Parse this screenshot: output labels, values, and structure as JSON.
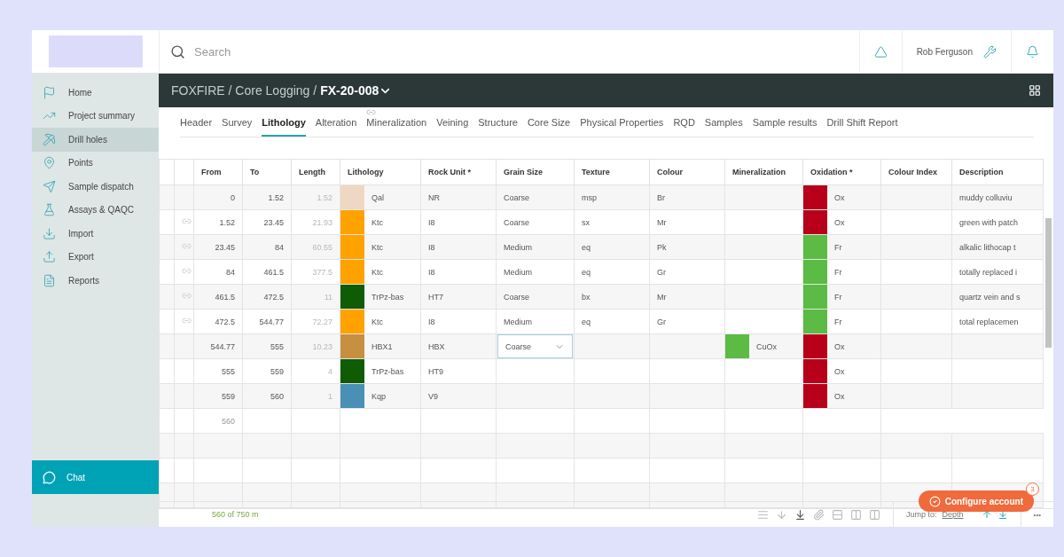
{
  "search": {
    "placeholder": "Search"
  },
  "user": {
    "name": "Rob Ferguson"
  },
  "sidebar": {
    "items": [
      {
        "label": "Home",
        "selected": false
      },
      {
        "label": "Project summary",
        "selected": false
      },
      {
        "label": "Drill holes",
        "selected": true
      },
      {
        "label": "Points",
        "selected": false
      },
      {
        "label": "Sample dispatch",
        "selected": false
      },
      {
        "label": "Assays & QAQC",
        "selected": false
      },
      {
        "label": "Import",
        "selected": false
      },
      {
        "label": "Export",
        "selected": false
      },
      {
        "label": "Reports",
        "selected": false
      }
    ],
    "chat": "Chat"
  },
  "breadcrumb": {
    "path": "FOXFIRE / Core Logging /",
    "current": "FX-20-008"
  },
  "tabs": [
    {
      "label": "Header",
      "selected": false,
      "linked": false
    },
    {
      "label": "Survey",
      "selected": false,
      "linked": false
    },
    {
      "label": "Lithology",
      "selected": true,
      "linked": false
    },
    {
      "label": "Alteration",
      "selected": false,
      "linked": false
    },
    {
      "label": "Mineralization",
      "selected": false,
      "linked": true
    },
    {
      "label": "Veining",
      "selected": false,
      "linked": false
    },
    {
      "label": "Structure",
      "selected": false,
      "linked": false
    },
    {
      "label": "Core Size",
      "selected": false,
      "linked": false
    },
    {
      "label": "Physical Properties",
      "selected": false,
      "linked": false
    },
    {
      "label": "RQD",
      "selected": false,
      "linked": false
    },
    {
      "label": "Samples",
      "selected": false,
      "linked": false
    },
    {
      "label": "Sample results",
      "selected": false,
      "linked": false
    },
    {
      "label": "Drill Shift Report",
      "selected": false,
      "linked": false
    }
  ],
  "table": {
    "columns": [
      "From",
      "To",
      "Length",
      "Lithology",
      "Rock Unit *",
      "Grain Size",
      "Texture",
      "Colour",
      "Mineralization",
      "Oxidation *",
      "Colour Index",
      "Description"
    ],
    "rows": [
      {
        "linked": false,
        "editing": false,
        "from": "0",
        "to": "1.52",
        "length": "1.52",
        "lithology": {
          "name": "Qal",
          "color": "#efd8c2"
        },
        "rock_unit": "NR",
        "grain_size": "Coarse",
        "texture": "msp",
        "colour": "Br",
        "oxidation": {
          "name": "Ox",
          "color": "#b8001a"
        },
        "description": "muddy colluviu"
      },
      {
        "linked": true,
        "editing": false,
        "from": "1.52",
        "to": "23.45",
        "length": "21.93",
        "lithology": {
          "name": "Ktc",
          "color": "#ffa200"
        },
        "rock_unit": "I8",
        "grain_size": "Coarse",
        "texture": "sx",
        "colour": "Mr",
        "oxidation": {
          "name": "Ox",
          "color": "#b8001a"
        },
        "description": "green with patch"
      },
      {
        "linked": true,
        "editing": false,
        "from": "23.45",
        "to": "84",
        "length": "60.55",
        "lithology": {
          "name": "Ktc",
          "color": "#ffa200"
        },
        "rock_unit": "I8",
        "grain_size": "Medium",
        "texture": "eq",
        "colour": "Pk",
        "oxidation": {
          "name": "Fr",
          "color": "#5bbb44"
        },
        "description": "alkalic lithocap t"
      },
      {
        "linked": true,
        "editing": false,
        "from": "84",
        "to": "461.5",
        "length": "377.5",
        "lithology": {
          "name": "Ktc",
          "color": "#ffa200"
        },
        "rock_unit": "I8",
        "grain_size": "Medium",
        "texture": "eq",
        "colour": "Gr",
        "oxidation": {
          "name": "Fr",
          "color": "#5bbb44"
        },
        "description": "totally replaced i"
      },
      {
        "linked": true,
        "editing": false,
        "from": "461.5",
        "to": "472.5",
        "length": "11",
        "lithology": {
          "name": "TrPz-bas",
          "color": "#0f5c05"
        },
        "rock_unit": "HT7",
        "grain_size": "Coarse",
        "texture": "bx",
        "colour": "Mr",
        "oxidation": {
          "name": "Fr",
          "color": "#5bbb44"
        },
        "description": "quartz vein and s"
      },
      {
        "linked": true,
        "editing": false,
        "from": "472.5",
        "to": "544.77",
        "length": "72.27",
        "lithology": {
          "name": "Ktc",
          "color": "#ffa200"
        },
        "rock_unit": "I8",
        "grain_size": "Medium",
        "texture": "eq",
        "colour": "Gr",
        "oxidation": {
          "name": "Fr",
          "color": "#5bbb44"
        },
        "description": "total replacemen"
      },
      {
        "linked": false,
        "editing": true,
        "from": "544.77",
        "to": "555",
        "length": "10.23",
        "lithology": {
          "name": "HBX1",
          "color": "#c69040"
        },
        "rock_unit": "HBX",
        "grain_size": "Coarse",
        "mineralization": {
          "name": "CuOx",
          "color": "#5bbb44"
        },
        "oxidation": {
          "name": "Ox",
          "color": "#b8001a"
        }
      },
      {
        "linked": false,
        "editing": false,
        "from": "555",
        "to": "559",
        "length": "4",
        "lithology": {
          "name": "TrPz-bas",
          "color": "#0f5c05"
        },
        "rock_unit": "HT9",
        "oxidation": {
          "name": "Ox",
          "color": "#b8001a"
        }
      },
      {
        "linked": false,
        "editing": false,
        "from": "559",
        "to": "560",
        "length": "1",
        "lithology": {
          "name": "Kqp",
          "color": "#4a8fb5"
        },
        "rock_unit": "V9",
        "oxidation": {
          "name": "Ox",
          "color": "#b8001a"
        }
      }
    ],
    "new_row": {
      "from_placeholder": "560"
    }
  },
  "footer": {
    "progress": "560 of 750 m",
    "jump_label": "Jump to:",
    "jump_value": "Depth",
    "more": "•••"
  },
  "configure": {
    "label": "Configure account",
    "badge": "3"
  }
}
